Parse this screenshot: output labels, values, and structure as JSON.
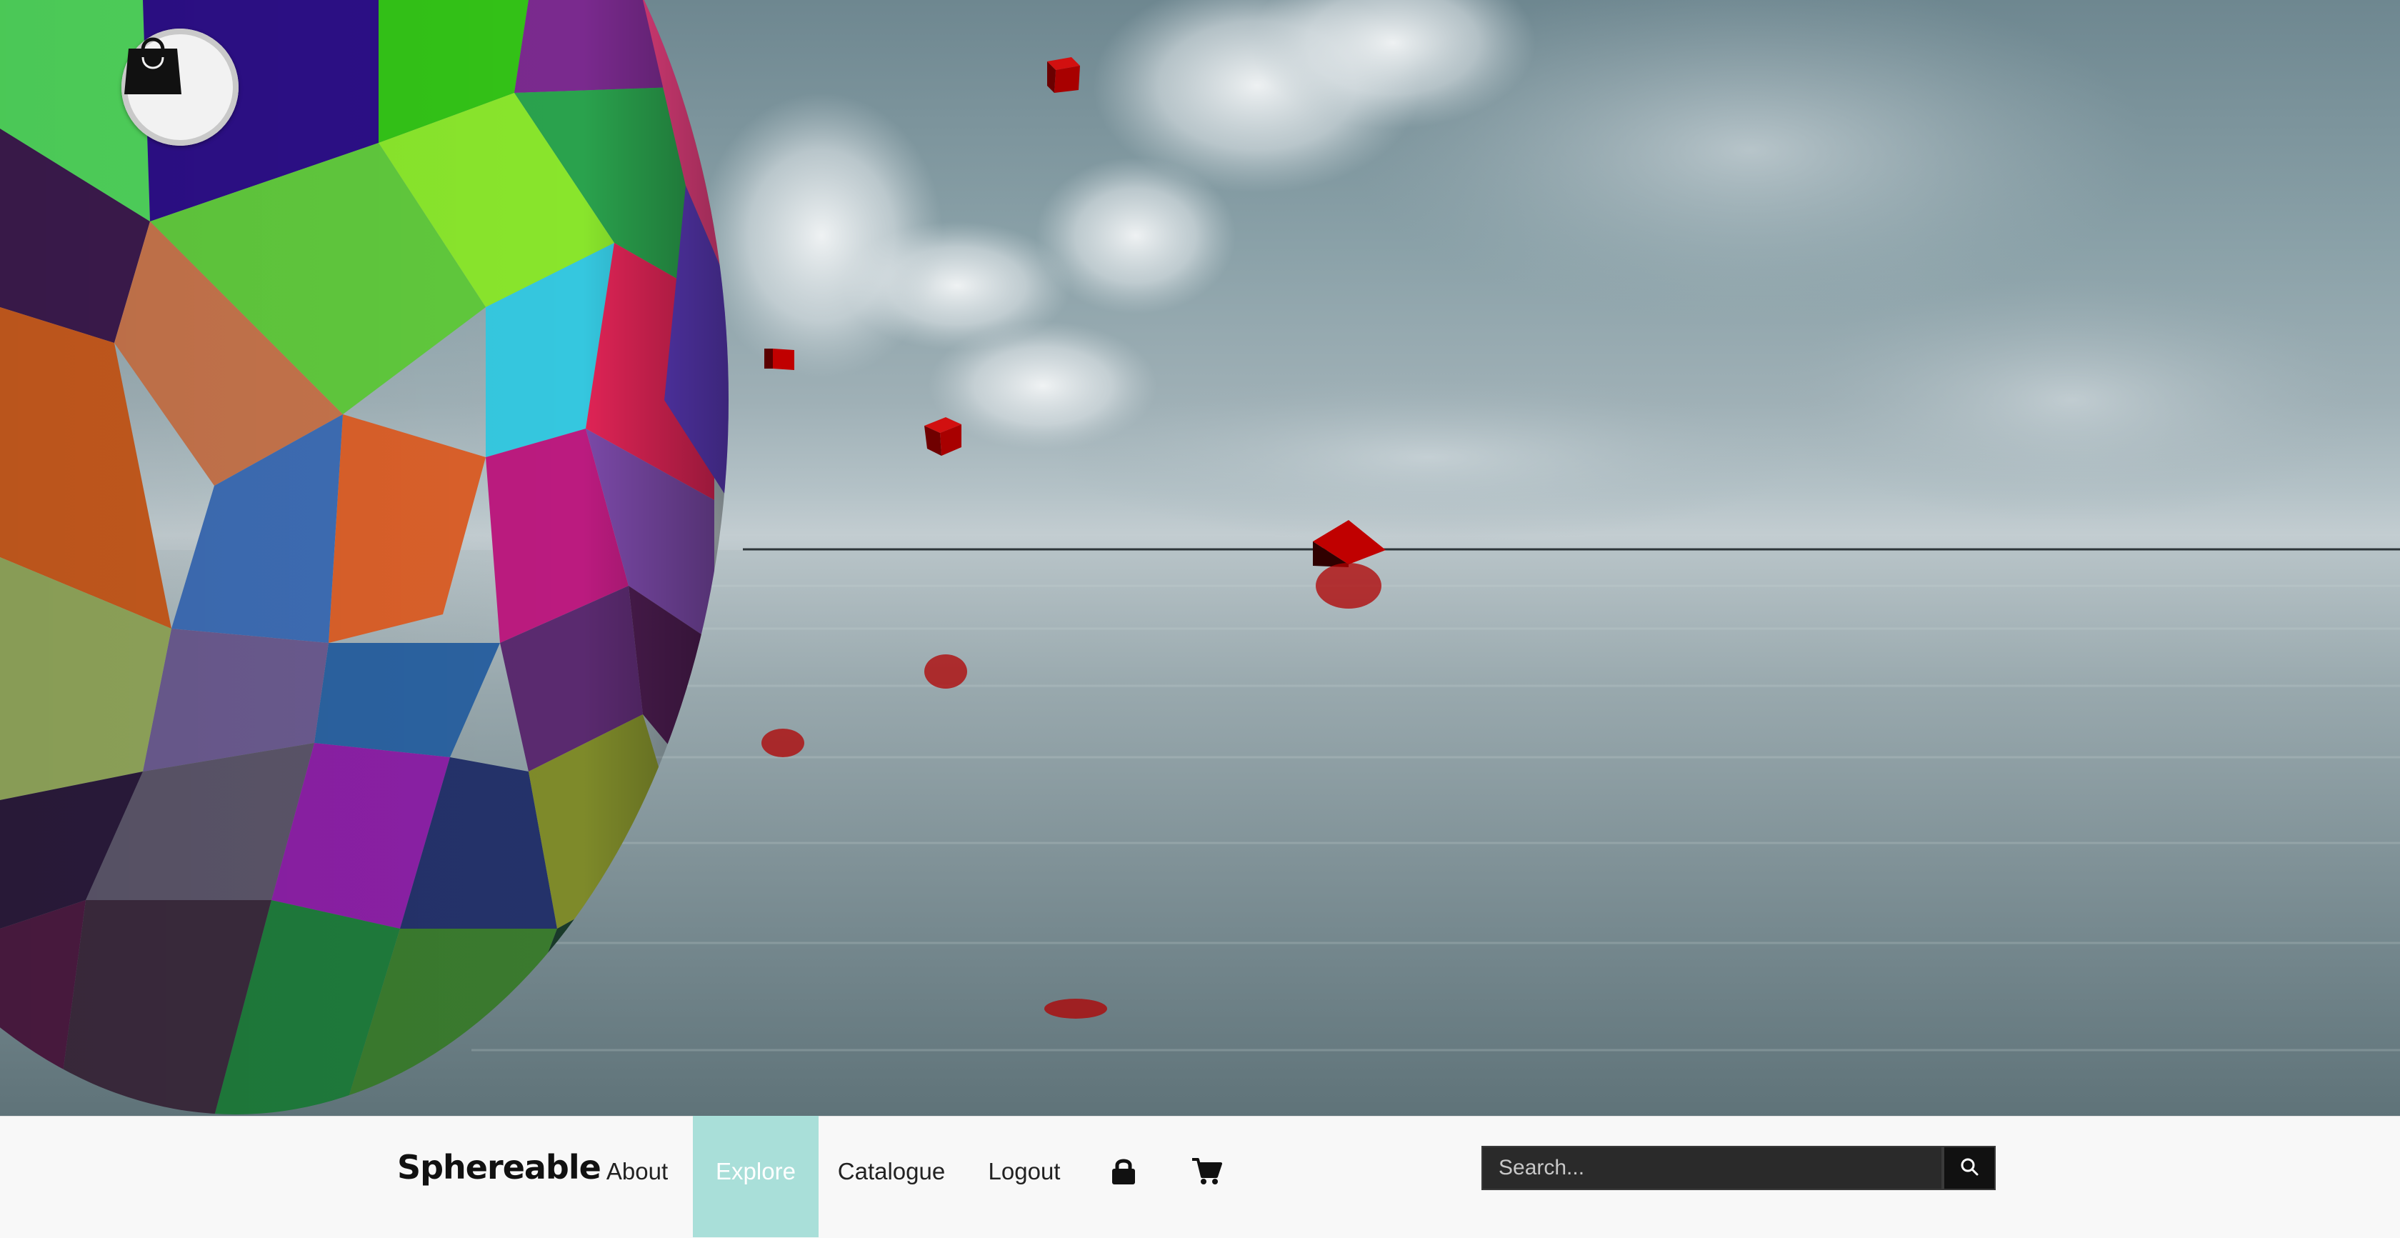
{
  "nav": {
    "brand": "Sphereable",
    "links": [
      {
        "label": "About"
      },
      {
        "label": "Explore",
        "active": true
      },
      {
        "label": "Catalogue"
      },
      {
        "label": "Logout"
      }
    ],
    "lock_icon": "lock-icon",
    "cart_icon": "cart-icon"
  },
  "search": {
    "placeholder": "Search...",
    "button_icon": "search-icon"
  },
  "overlay": {
    "shop_bag_icon": "shopping-bag-icon"
  },
  "colors": {
    "nav_background": "#f8f8f8",
    "active_tab": "#a9dfd9",
    "cube_red": "#b30000",
    "search_background": "#2a2a2a"
  }
}
